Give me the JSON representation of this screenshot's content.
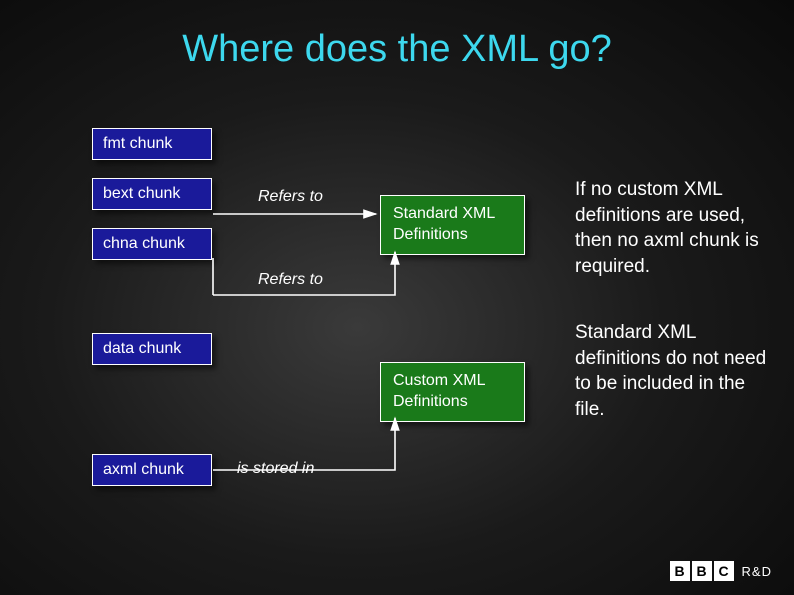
{
  "title": "Where does the XML go?",
  "chunks": {
    "fmt": "fmt chunk",
    "bext": "bext chunk",
    "chna": "chna chunk",
    "data": "data chunk",
    "axml": "axml chunk"
  },
  "defs": {
    "std": "Standard XML Definitions",
    "custom": "Custom XML Definitions"
  },
  "edges": {
    "refers1": "Refers to",
    "refers2": "Refers to",
    "stored": "is stored in"
  },
  "body": {
    "p1": "If no custom XML definitions are used, then no axml chunk is required.",
    "p2": "Standard XML definitions do not need to be included in the file."
  },
  "logo": {
    "b1": "B",
    "b2": "B",
    "b3": "C",
    "rd": "R&D"
  }
}
